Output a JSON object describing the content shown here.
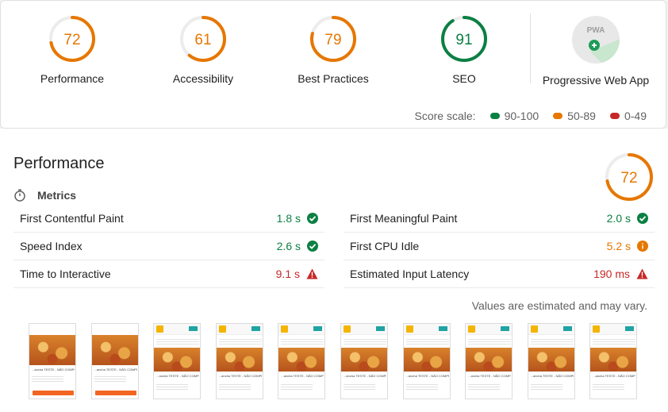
{
  "summary": {
    "gauges": [
      {
        "label": "Performance",
        "score": "72",
        "score_value": 72,
        "color": "#e67700"
      },
      {
        "label": "Accessibility",
        "score": "61",
        "score_value": 61,
        "color": "#e67700"
      },
      {
        "label": "Best Practices",
        "score": "79",
        "score_value": 79,
        "color": "#e67700"
      },
      {
        "label": "SEO",
        "score": "91",
        "score_value": 91,
        "color": "#0b8043"
      }
    ],
    "pwa": {
      "label": "Progressive Web App",
      "badge_text": "PWA",
      "icon": "pwa-badge-icon"
    },
    "scale": {
      "label": "Score scale:",
      "ranges": [
        {
          "label": "90-100",
          "color": "#0b8043"
        },
        {
          "label": "50-89",
          "color": "#e67700"
        },
        {
          "label": "0-49",
          "color": "#c62828"
        }
      ]
    }
  },
  "performance": {
    "title": "Performance",
    "score": "72",
    "score_value": 72,
    "metrics_heading": "Metrics",
    "metrics_left": [
      {
        "label": "First Contentful Paint",
        "value": "1.8 s",
        "status": "pass",
        "icon": "check-circle-icon"
      },
      {
        "label": "Speed Index",
        "value": "2.6 s",
        "status": "pass",
        "icon": "check-circle-icon"
      },
      {
        "label": "Time to Interactive",
        "value": "9.1 s",
        "status": "fail",
        "icon": "warning-triangle-icon"
      }
    ],
    "metrics_right": [
      {
        "label": "First Meaningful Paint",
        "value": "2.0 s",
        "status": "pass",
        "icon": "check-circle-icon"
      },
      {
        "label": "First CPU Idle",
        "value": "5.2 s",
        "status": "average",
        "icon": "info-circle-icon"
      },
      {
        "label": "Estimated Input Latency",
        "value": "190 ms",
        "status": "fail",
        "icon": "warning-triangle-icon"
      }
    ],
    "estimate_note": "Values are estimated and may vary.",
    "filmstrip_caption": "...ancha TESTE - NÃO COMPRAR",
    "filmstrip_count": 10
  }
}
